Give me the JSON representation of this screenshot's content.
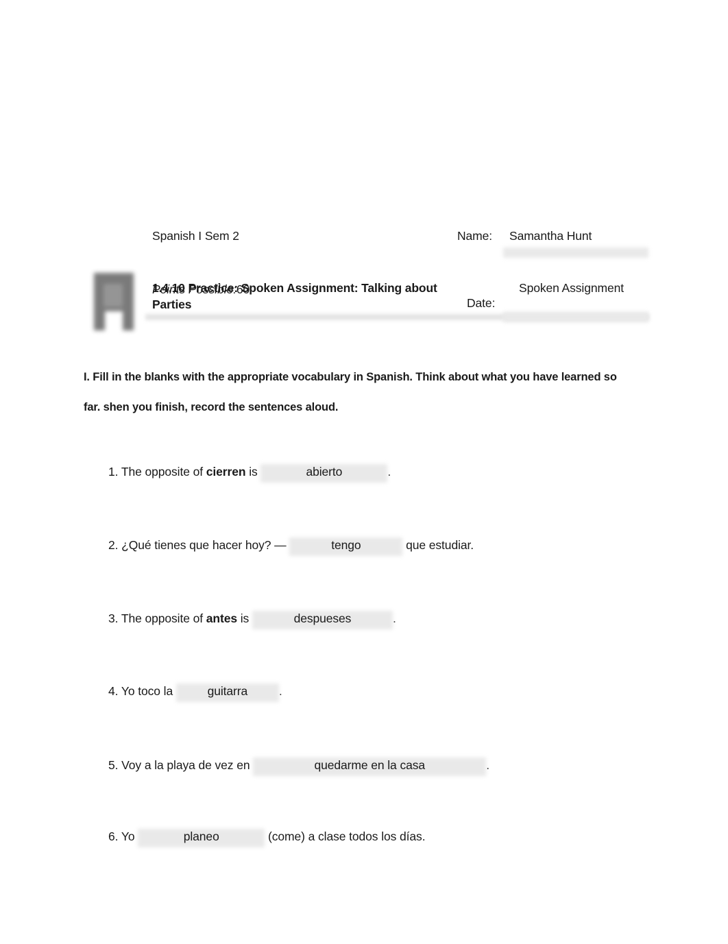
{
  "document": {
    "title": "1.4.10 Practice: Spoken Assignment: Talking about Parties",
    "assignment_kind": "Spoken Assignment",
    "logo_icon": "bookmark-ribbon-icon",
    "course": "Spanish I Sem 2",
    "points_possible_label": "Points Possible:",
    "points_possible_value": "60",
    "name_label": "Name:",
    "name_value": "Samantha Hunt",
    "date_label": "Date:",
    "date_value": ""
  },
  "instructions": {
    "text": "I. Fill in the blanks with the appropriate vocabulary in Spanish. Think about what you have learned so far. shen you finish, record the sentences aloud."
  },
  "questions": [
    {
      "number": "1.",
      "pre": "The opposite of ",
      "bold": "cierren",
      "mid": " is ",
      "answer": "abierto",
      "post": "."
    },
    {
      "number": "2.",
      "pre": "¿Qué tienes que hacer hoy? — ",
      "bold": "",
      "mid": "",
      "answer": "tengo",
      "post": " que estudiar."
    },
    {
      "number": "3.",
      "pre": "The opposite of ",
      "bold": "antes",
      "mid": " is ",
      "answer": "despueses",
      "post": "."
    },
    {
      "number": "4.",
      "pre": "Yo toco la ",
      "bold": "",
      "mid": "",
      "answer": "guitarra",
      "post": "."
    },
    {
      "number": "5.",
      "pre": "Voy a la playa de vez en ",
      "bold": "",
      "mid": "",
      "answer": "quedarme en la casa",
      "post": "."
    },
    {
      "number": "6.",
      "pre": "Yo ",
      "bold": "",
      "mid": "",
      "answer": "planeo",
      "post": " (come) a clase todos los días."
    }
  ],
  "colors": {
    "page_background": "#ffffff",
    "text": "#1a1a1a",
    "blank_fill": "#e9e9e9",
    "rule": "#e4e4e4",
    "logo_gray": "#6f6f6f"
  }
}
